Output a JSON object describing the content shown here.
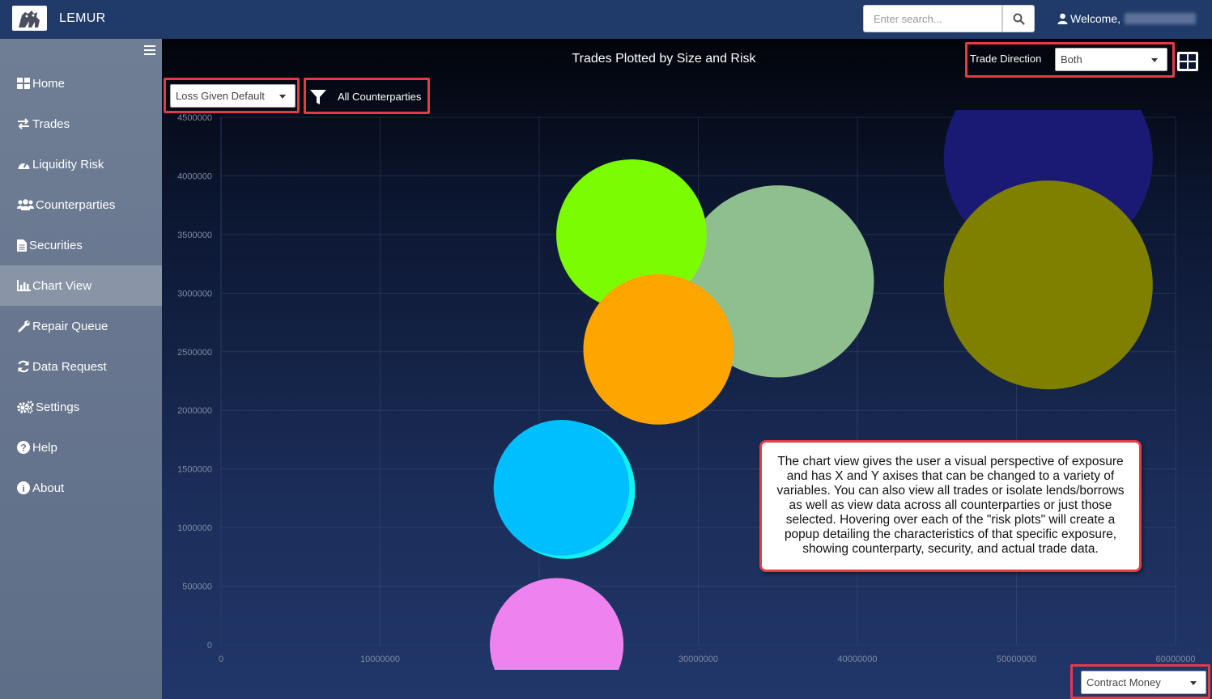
{
  "app": {
    "title": "LEMUR",
    "logo_icon": "lemur-logo"
  },
  "header": {
    "search_placeholder": "Enter search...",
    "welcome": "Welcome,"
  },
  "sidebar": {
    "items": [
      {
        "label": "Home",
        "icon": "home-grid-icon"
      },
      {
        "label": "Trades",
        "icon": "exchange-icon"
      },
      {
        "label": "Liquidity Risk",
        "icon": "dashboard-gauge-icon"
      },
      {
        "label": "Counterparties",
        "icon": "users-icon"
      },
      {
        "label": "Securities",
        "icon": "document-icon"
      },
      {
        "label": "Chart View",
        "icon": "bar-chart-icon",
        "active": true
      },
      {
        "label": "Repair Queue",
        "icon": "wrench-icon"
      },
      {
        "label": "Data Request",
        "icon": "refresh-icon"
      },
      {
        "label": "Settings",
        "icon": "gears-icon"
      },
      {
        "label": "Help",
        "icon": "question-circle-icon"
      },
      {
        "label": "About",
        "icon": "info-circle-icon"
      }
    ]
  },
  "controls": {
    "y_axis_select": "Loss Given Default",
    "filter_label": "All Counterparties",
    "trade_direction_label": "Trade Direction",
    "trade_direction_value": "Both",
    "x_axis_select": "Contract Money"
  },
  "chart_data": {
    "type": "scatter",
    "title": "Trades Plotted by Size and Risk",
    "xlim": [
      0,
      60000000
    ],
    "ylim": [
      0,
      4500000
    ],
    "x_ticks": [
      "0",
      "10000000",
      "20000000",
      "30000000",
      "40000000",
      "50000000",
      "60000000"
    ],
    "x_tick_labels_shown": [
      "0",
      "10000000",
      "",
      "30000000",
      "40000000",
      "50000000",
      "60000000"
    ],
    "y_ticks": [
      "0",
      "500000",
      "1000000",
      "1500000",
      "2000000",
      "2500000",
      "3000000",
      "3500000",
      "4000000",
      "4500000"
    ],
    "grid": true,
    "bubbles": [
      {
        "x": 52000000,
        "y": 4150000,
        "r": 1,
        "color": "#1a1a75"
      },
      {
        "x": 35000000,
        "y": 3100000,
        "r": 0.92,
        "color": "#8fbf8f"
      },
      {
        "x": 25800000,
        "y": 3500000,
        "r": 0.72,
        "color": "#7cfc00"
      },
      {
        "x": 27500000,
        "y": 2520000,
        "r": 0.72,
        "color": "#ffa500"
      },
      {
        "x": 52000000,
        "y": 3070000,
        "r": 1,
        "color": "#808000"
      },
      {
        "x": 21700000,
        "y": 1320000,
        "r": 0.66,
        "color": "#14f0f0"
      },
      {
        "x": 21400000,
        "y": 1340000,
        "r": 0.65,
        "color": "#00bfff"
      },
      {
        "x": 21100000,
        "y": 0,
        "r": 0.64,
        "color": "#ee82ee"
      }
    ]
  },
  "callout": {
    "text": "The chart view gives the user a visual perspective of exposure and has X and Y axises  that can be changed to a variety of variables.  You can also view all trades or isolate lends/borrows as well as view data across all counterparties or just those selected.  Hovering over each of the \"risk plots\" will create a popup detailing the characteristics of that specific exposure, showing counterparty, security, and actual trade data."
  },
  "colors": {
    "topbar": "#203a6a",
    "sidebar": "#6b7990",
    "highlight": "#e53a47"
  }
}
